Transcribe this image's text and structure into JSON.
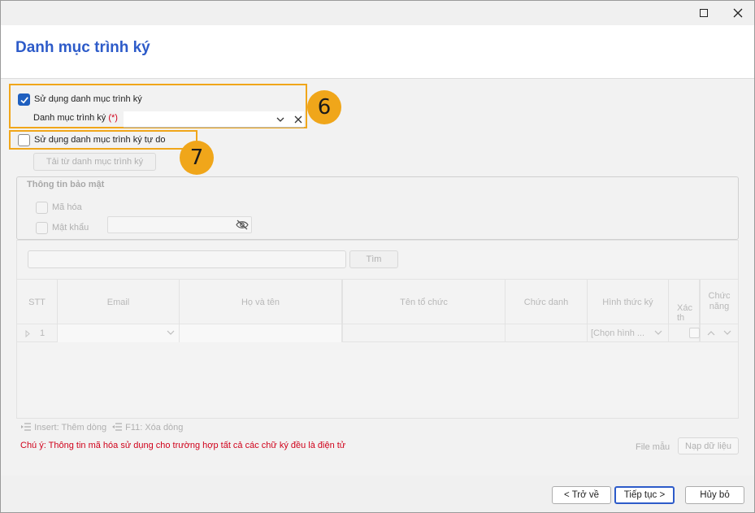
{
  "window": {
    "title": "Danh mục trình ký"
  },
  "options": {
    "use_list_label": "Sử dụng danh mục trình ký",
    "use_list_checked": true,
    "list_field_label": "Danh mục trình ký",
    "required_mark": "(*)",
    "list_field_value": "",
    "use_free_label": "Sử dụng danh mục trình ký tự do",
    "use_free_checked": false,
    "load_button_label": "Tải từ danh mục trình ký"
  },
  "callouts": {
    "six": "6",
    "seven": "7"
  },
  "security": {
    "title": "Thông tin bảo mật",
    "encrypt_label": "Mã hóa",
    "password_label": "Mật khẩu",
    "password_value": ""
  },
  "search": {
    "value": "",
    "button_label": "Tìm"
  },
  "table": {
    "columns": [
      "STT",
      "Email",
      "Họ và tên",
      "Tên tổ chức",
      "Chức danh",
      "Hình thức ký",
      "Xác th",
      "Chức năng"
    ],
    "rows": [
      {
        "stt": "1",
        "email": "",
        "full_name": "",
        "organization": "",
        "position": "",
        "sign_type": "[Chọn hình ...",
        "verify": ""
      }
    ]
  },
  "hints": {
    "insert": "Insert: Thêm dòng",
    "delete": "F11: Xóa dòng"
  },
  "note": "Chú ý: Thông tin mã hóa sử dụng cho trường hợp tất cả các chữ ký đều là điện tử",
  "data_links": {
    "template_file": "File mẫu",
    "import_data": "Nạp dữ liệu"
  },
  "footer": {
    "back": "< Trở về",
    "next": "Tiếp tục >",
    "cancel": "Hủy bỏ"
  }
}
